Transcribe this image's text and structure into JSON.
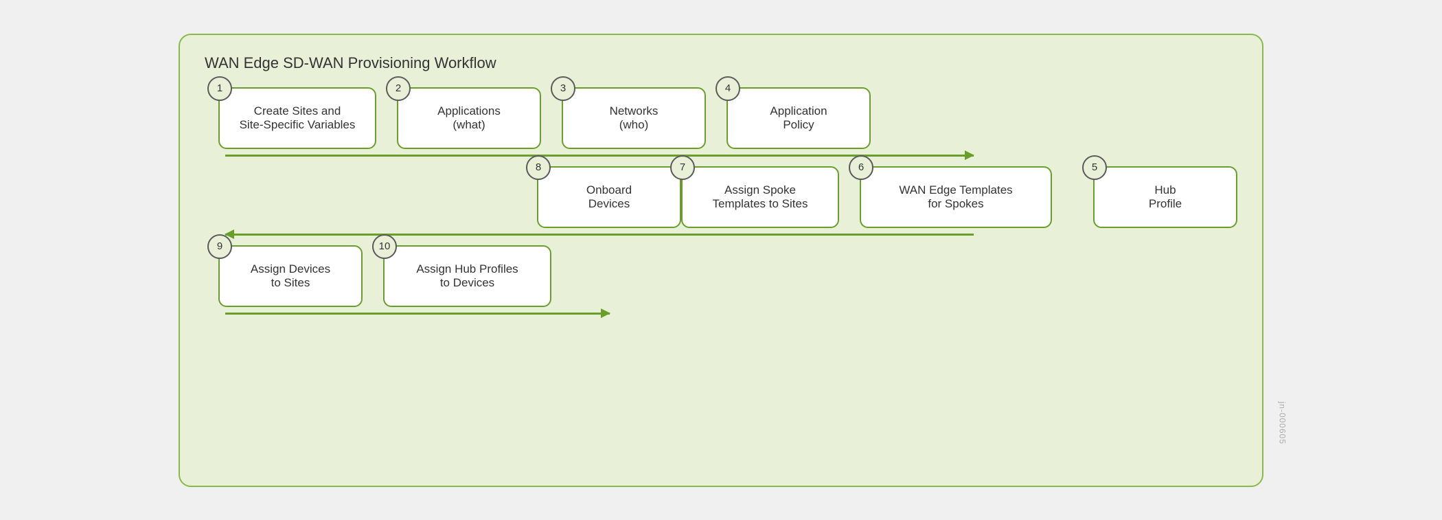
{
  "diagram": {
    "title": "WAN Edge SD-WAN Provisioning Workflow",
    "watermark": "jn-000605",
    "row1": {
      "steps": [
        {
          "num": "1",
          "label": "Create Sites and\nSite-Specific Variables",
          "size": "wide"
        },
        {
          "num": "2",
          "label": "Applications\n(what)",
          "size": "medium"
        },
        {
          "num": "3",
          "label": "Networks\n(who)",
          "size": "medium"
        },
        {
          "num": "4",
          "label": "Application\nPolicy",
          "size": "medium"
        }
      ],
      "arrow_direction": "right"
    },
    "row2": {
      "steps": [
        {
          "num": "8",
          "label": "Onboard\nDevices",
          "size": "medium"
        },
        {
          "num": "7",
          "label": "Assign Spoke\nTemplates to Sites",
          "size": "wide"
        },
        {
          "num": "6",
          "label": "WAN Edge Templates\nfor Spokes",
          "size": "wide"
        },
        {
          "num": "5",
          "label": "Hub\nProfile",
          "size": "medium"
        }
      ],
      "arrow_direction": "left"
    },
    "row3": {
      "steps": [
        {
          "num": "9",
          "label": "Assign Devices\nto Sites",
          "size": "medium"
        },
        {
          "num": "10",
          "label": "Assign Hub Profiles\nto Devices",
          "size": "wide"
        }
      ],
      "arrow_direction": "right"
    }
  }
}
